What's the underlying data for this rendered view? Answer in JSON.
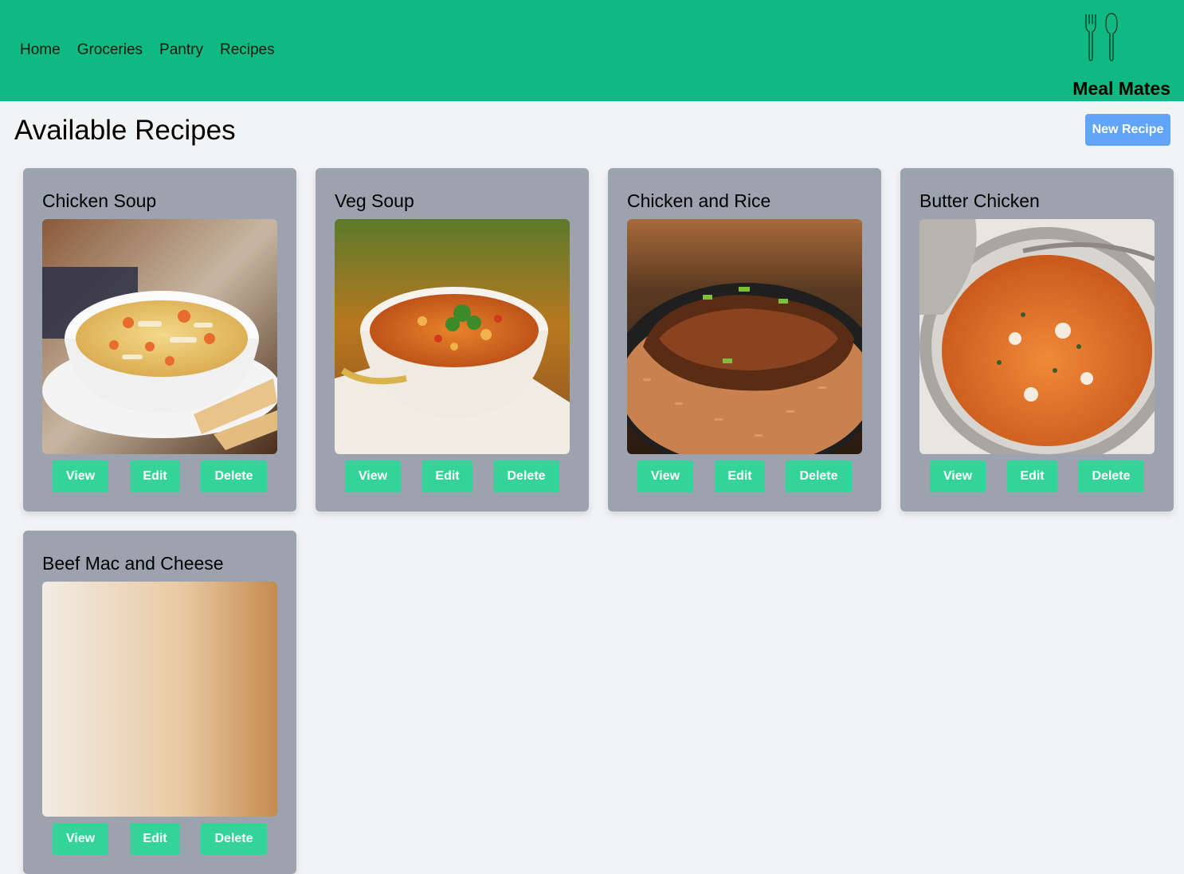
{
  "nav": {
    "links": [
      "Home",
      "Groceries",
      "Pantry",
      "Recipes"
    ],
    "brand": "Meal Mates",
    "brand_icon": "fork-and-spoon-icon"
  },
  "page": {
    "title": "Available Recipes",
    "new_recipe_label": "New Recipe"
  },
  "recipes": [
    {
      "name": "Chicken Soup",
      "view": "View",
      "edit": "Edit",
      "delete": "Delete"
    },
    {
      "name": "Veg Soup",
      "view": "View",
      "edit": "Edit",
      "delete": "Delete"
    },
    {
      "name": "Chicken and Rice",
      "view": "View",
      "edit": "Edit",
      "delete": "Delete"
    },
    {
      "name": "Butter Chicken",
      "view": "View",
      "edit": "Edit",
      "delete": "Delete"
    },
    {
      "name": "Beef Mac and Cheese",
      "view": "View",
      "edit": "Edit",
      "delete": "Delete"
    }
  ],
  "colors": {
    "nav_bg": "#10b981",
    "page_bg": "#f2f3f5",
    "card_bg": "#9ca3af",
    "action_button": "#34d399",
    "new_recipe_button": "#60a5fa"
  }
}
